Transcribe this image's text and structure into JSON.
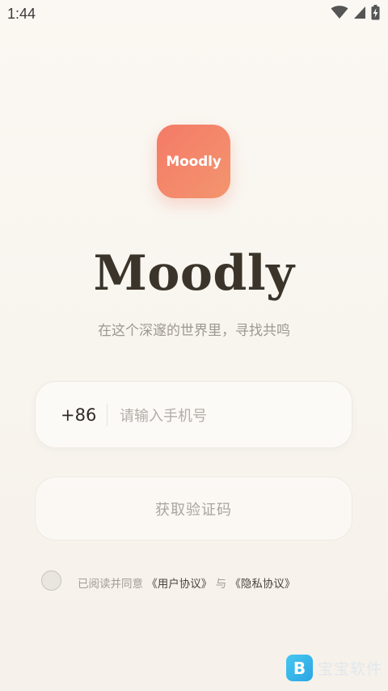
{
  "status_bar": {
    "time": "1:44",
    "icons": [
      "wifi-icon",
      "signal-icon",
      "battery-charging-icon"
    ]
  },
  "app": {
    "icon_label": "Moodly",
    "title": "Moodly",
    "subtitle": "在这个深邃的世界里，寻找共鸣",
    "brand_gradient": [
      "#f47a67",
      "#f3956e"
    ]
  },
  "login": {
    "country_code": "+86",
    "phone_placeholder": "请输入手机号",
    "phone_value": "",
    "get_code_label": "获取验证码"
  },
  "agreement": {
    "checked": false,
    "prefix": "已阅读并同意 ",
    "user_agreement": "《用户协议》",
    "connector": " 与 ",
    "privacy_policy": "《隐私协议》"
  },
  "watermark": {
    "logo": "B",
    "text": "宝宝软件"
  }
}
